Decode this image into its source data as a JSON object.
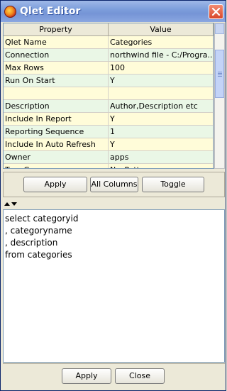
{
  "window": {
    "title": "Qlet Editor"
  },
  "grid": {
    "headers": [
      "Property",
      "Value"
    ],
    "rows": [
      {
        "property": "Qlet Name",
        "value": "Categories"
      },
      {
        "property": "Connection",
        "value": "northwind file - C:/Progra..."
      },
      {
        "property": "Max Rows",
        "value": "100"
      },
      {
        "property": "Run On Start",
        "value": "Y"
      },
      {
        "property": "",
        "value": ""
      },
      {
        "property": "Description",
        "value": "Author,Description etc"
      },
      {
        "property": "Include In Report",
        "value": "Y"
      },
      {
        "property": "Reporting Sequence",
        "value": "1"
      },
      {
        "property": "Include In Auto Refresh",
        "value": "Y"
      },
      {
        "property": "Owner",
        "value": "apps"
      },
      {
        "property": "Tree Group",
        "value": "No_Pattern"
      }
    ]
  },
  "toolbar1": {
    "apply": "Apply",
    "all_columns": "All Columns",
    "toggle": "Toggle"
  },
  "editor": {
    "lines": [
      "select categoryid",
      ", categoryname",
      ", description",
      "from categories"
    ]
  },
  "toolbar2": {
    "apply": "Apply",
    "close": "Close"
  }
}
